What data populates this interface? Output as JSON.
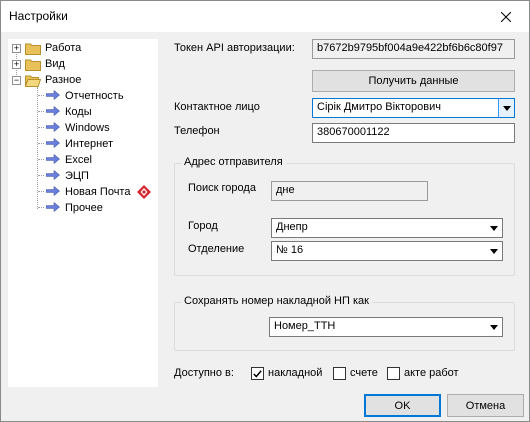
{
  "window": {
    "title": "Настройки"
  },
  "tree": {
    "items": [
      {
        "label": "Работа",
        "expander": "+"
      },
      {
        "label": "Вид",
        "expander": "+"
      },
      {
        "label": "Разное",
        "expander": "−"
      }
    ],
    "children": [
      {
        "label": "Отчетность"
      },
      {
        "label": "Коды"
      },
      {
        "label": "Windows"
      },
      {
        "label": "Интернет"
      },
      {
        "label": "Excel"
      },
      {
        "label": "ЭЦП"
      },
      {
        "label": "Новая Почта"
      },
      {
        "label": "Прочее"
      }
    ]
  },
  "form": {
    "token_label": "Токен API авторизации:",
    "token_value": "b7672b9795bf004a9e422bf6b6c80f97",
    "get_data_button": "Получить данные",
    "contact_label": "Контактное лицо",
    "contact_value": "Сірік Дмитро Вікторович",
    "phone_label": "Телефон",
    "phone_value": "380670001122",
    "sender_group_title": "Адрес отправителя",
    "city_search_label": "Поиск города",
    "city_search_value": "дне",
    "city_label": "Город",
    "city_value": "Днепр",
    "branch_label": "Отделение",
    "branch_value": "№ 16",
    "save_group_title": "Сохранять номер накладной НП как",
    "save_as_value": "Номер_ТТН",
    "available_label": "Доступно в:",
    "checkboxes": [
      {
        "label": "накладной",
        "checked": true
      },
      {
        "label": "счете",
        "checked": false
      },
      {
        "label": "акте работ",
        "checked": false
      }
    ]
  },
  "footer": {
    "ok_button": "OK",
    "cancel_button": "Отмена"
  },
  "colors": {
    "accent": "#0078d7",
    "folder": "#e8c15a",
    "arrow": "#6b7fd7",
    "np_red": "#d7262e"
  }
}
